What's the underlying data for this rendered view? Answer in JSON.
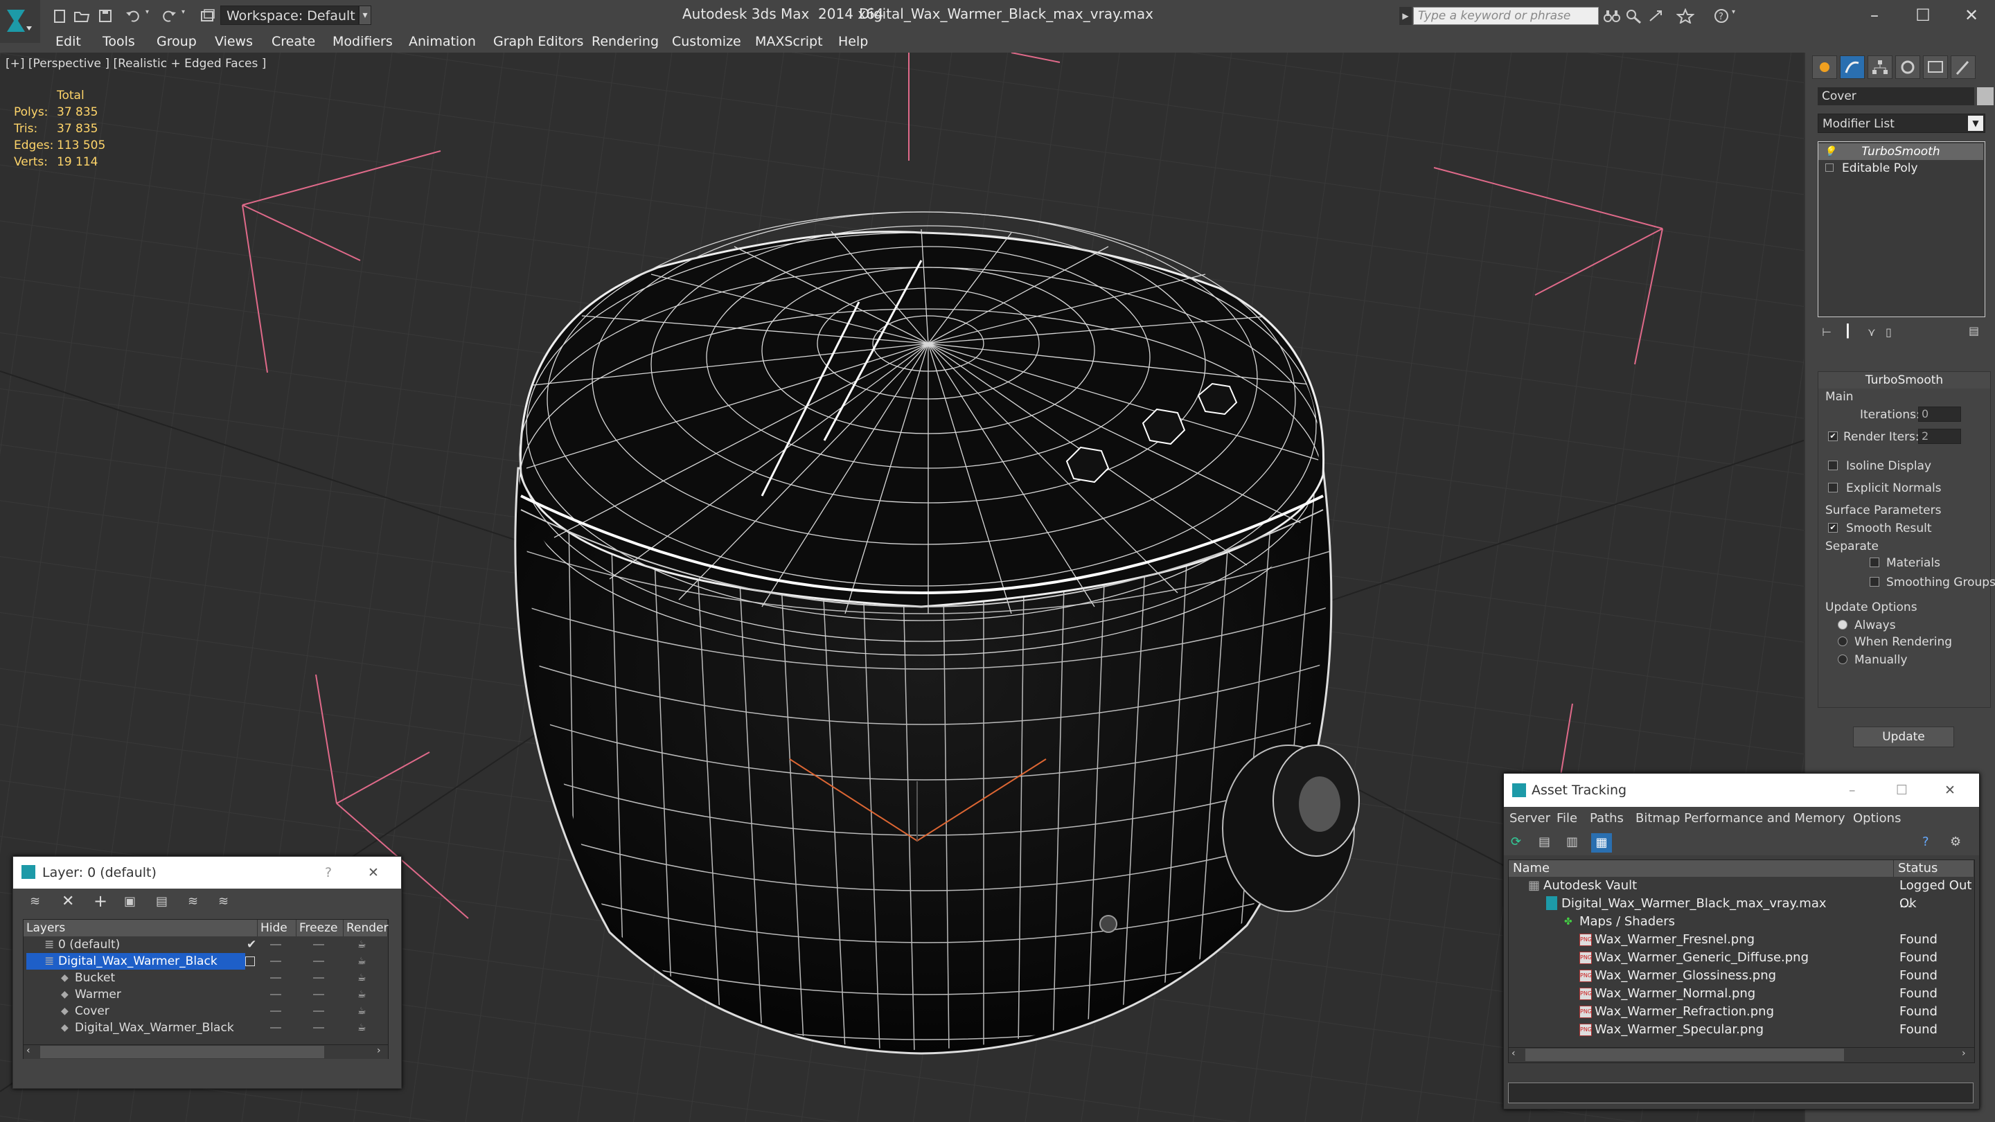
{
  "titlebar": {
    "workspace_label": "Workspace: Default",
    "app_title": "Autodesk 3ds Max  2014 x64",
    "document_title": "Digital_Wax_Warmer_Black_max_vray.max",
    "search_placeholder": "Type a keyword or phrase"
  },
  "menubar": {
    "items": [
      "Edit",
      "Tools",
      "Group",
      "Views",
      "Create",
      "Modifiers",
      "Animation",
      "Graph Editors",
      "Rendering",
      "Customize",
      "MAXScript",
      "Help"
    ]
  },
  "viewport": {
    "label": "[+] [Perspective ] [Realistic + Edged Faces ]",
    "stats": {
      "header": "Total",
      "rows": [
        {
          "label": "Polys:",
          "value": "37 835"
        },
        {
          "label": "Tris:",
          "value": "37 835"
        },
        {
          "label": "Edges:",
          "value": "113 505"
        },
        {
          "label": "Verts:",
          "value": "19 114"
        }
      ]
    }
  },
  "command_panel": {
    "object_name": "Cover",
    "modifier_list_label": "Modifier List",
    "stack": [
      "TurboSmooth",
      "Editable Poly"
    ],
    "rollout_title": "TurboSmooth",
    "main_label": "Main",
    "iterations_label": "Iterations:",
    "iterations_value": "0",
    "render_iters_label": "Render Iters:",
    "render_iters_value": "2",
    "isoline_label": "Isoline Display",
    "explicit_normals_label": "Explicit Normals",
    "surface_params_label": "Surface Parameters",
    "smooth_result_label": "Smooth Result",
    "separate_label": "Separate",
    "materials_label": "Materials",
    "smoothing_groups_label": "Smoothing Groups",
    "update_options_label": "Update Options",
    "always_label": "Always",
    "when_rendering_label": "When Rendering",
    "manually_label": "Manually",
    "update_button": "Update"
  },
  "layer_panel": {
    "title": "Layer: 0 (default)",
    "help": "?",
    "columns": [
      "Layers",
      "Hide",
      "Freeze",
      "Render"
    ],
    "rows": [
      {
        "name": "0 (default)",
        "selected": false
      },
      {
        "name": "Digital_Wax_Warmer_Black",
        "selected": true
      },
      {
        "name": "Bucket",
        "selected": false
      },
      {
        "name": "Warmer",
        "selected": false
      },
      {
        "name": "Cover",
        "selected": false
      },
      {
        "name": "Digital_Wax_Warmer_Black",
        "selected": false
      }
    ]
  },
  "asset_tracking": {
    "title": "Asset Tracking",
    "menu": [
      "Server",
      "File",
      "Paths",
      "Bitmap Performance and Memory",
      "Options"
    ],
    "columns": [
      "Name",
      "Status"
    ],
    "rows": [
      {
        "name": "Autodesk Vault",
        "status": "Logged Out ..."
      },
      {
        "name": "Digital_Wax_Warmer_Black_max_vray.max",
        "status": "Ok"
      },
      {
        "name": "Maps / Shaders",
        "status": ""
      },
      {
        "name": "Wax_Warmer_Fresnel.png",
        "status": "Found"
      },
      {
        "name": "Wax_Warmer_Generic_Diffuse.png",
        "status": "Found"
      },
      {
        "name": "Wax_Warmer_Glossiness.png",
        "status": "Found"
      },
      {
        "name": "Wax_Warmer_Normal.png",
        "status": "Found"
      },
      {
        "name": "Wax_Warmer_Refraction.png",
        "status": "Found"
      },
      {
        "name": "Wax_Warmer_Specular.png",
        "status": "Found"
      }
    ]
  },
  "colors": {
    "viewport_bg": "#2f2f2f",
    "stats_text": "#ffd56a",
    "selection": "#1e5fc8",
    "grid_lines": "#e06080"
  }
}
